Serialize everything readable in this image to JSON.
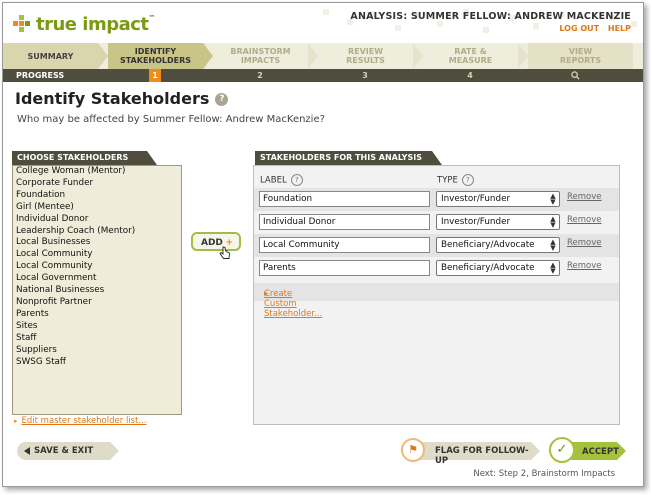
{
  "app": {
    "logo_text": "true impact",
    "logo_tm": "™",
    "analysis_title": "ANALYSIS: SUMMER FELLOW: ANDREW MACKENZIE",
    "logout_label": "LOG OUT",
    "help_label": "HELP",
    "colors": {
      "accent_orange": "#f08c1a",
      "brand_green": "#7a9a12",
      "dark_bar": "#4f4e3e"
    }
  },
  "tabs": [
    {
      "label": "SUMMARY",
      "state": "done"
    },
    {
      "label": "IDENTIFY\nSTAKEHOLDERS",
      "state": "active"
    },
    {
      "label": "BRAINSTORM\nIMPACTS",
      "state": "inactive"
    },
    {
      "label": "REVIEW\nRESULTS",
      "state": "inactive"
    },
    {
      "label": "RATE &\nMEASURE",
      "state": "inactive"
    },
    {
      "label": "VIEW\nREPORTS",
      "state": "inactive"
    }
  ],
  "progress": {
    "label": "PROGRESS",
    "steps": [
      "1",
      "2",
      "3",
      "4"
    ],
    "current": "1",
    "reports_icon": "magnifier-icon"
  },
  "page": {
    "title": "Identify Stakeholders",
    "help_icon": "?",
    "subtitle": "Who may be affected by Summer Fellow: Andrew MacKenzie?"
  },
  "choose": {
    "header": "CHOOSE STAKEHOLDERS",
    "items": [
      "College Woman (Mentor)",
      "Corporate Funder",
      "Foundation",
      "Girl (Mentee)",
      "Individual Donor",
      "Leadership Coach (Mentor)",
      "Local Businesses",
      "Local Community",
      "Local Community",
      "Local Government",
      "National Businesses",
      "Nonprofit Partner",
      "Parents",
      "Sites",
      "Staff",
      "Suppliers",
      "SWSG Staff"
    ],
    "edit_link": "Edit master stakeholder list..."
  },
  "add_button": {
    "label": "ADD",
    "plus": "+"
  },
  "analysis": {
    "header": "STAKEHOLDERS FOR THIS ANALYSIS",
    "label_col": "LABEL",
    "type_col": "TYPE",
    "rows": [
      {
        "label": "Foundation",
        "type": "Investor/Funder",
        "remove": "Remove"
      },
      {
        "label": "Individual Donor",
        "type": "Investor/Funder",
        "remove": "Remove"
      },
      {
        "label": "Local Community",
        "type": "Beneficiary/Advocate",
        "remove": "Remove"
      },
      {
        "label": "Parents",
        "type": "Beneficiary/Advocate",
        "remove": "Remove"
      }
    ],
    "create_link": "Create Custom Stakeholder..."
  },
  "footer": {
    "save_exit": "SAVE & EXIT",
    "flag": "FLAG FOR FOLLOW-UP",
    "accept": "ACCEPT",
    "next_step": "Next: Step 2, Brainstorm Impacts"
  }
}
